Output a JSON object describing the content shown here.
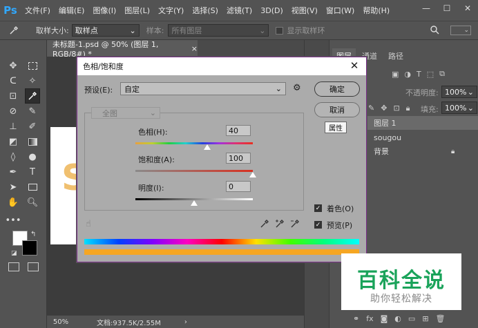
{
  "app": {
    "logo": "Ps",
    "menu": [
      "文件(F)",
      "编辑(E)",
      "图像(I)",
      "图层(L)",
      "文字(Y)",
      "选择(S)",
      "滤镜(T)",
      "3D(D)",
      "视图(V)",
      "窗口(W)",
      "帮助(H)"
    ],
    "window_controls": [
      "—",
      "☐",
      "✕"
    ]
  },
  "options_bar": {
    "sample_size_label": "取样大小:",
    "sample_size_value": "取样点",
    "sample_label": "样本:",
    "sample_value": "所有图层",
    "show_ring_label": "显示取样环"
  },
  "document": {
    "tab_title": "未标题-1.psd @ 50% (图层 1, RGB/8#) *",
    "tab_close": "×",
    "zoom": "50%",
    "doc_info": "文档:937.5K/2.55M",
    "canvas_letter": "S"
  },
  "layers_panel": {
    "tabs": [
      "图层",
      "通道",
      "路径"
    ],
    "opacity_label": "不透明度:",
    "opacity_value": "100%",
    "fill_label": "填充:",
    "fill_value": "100%",
    "layers": [
      {
        "name": "图层 1"
      },
      {
        "name": "sougou"
      },
      {
        "name": "背景"
      }
    ]
  },
  "dialog": {
    "title": "色相/饱和度",
    "preset_label": "预设(E):",
    "preset_value": "自定",
    "channel_value": "全图",
    "hue_label": "色相(H):",
    "hue_value": "40",
    "saturation_label": "饱和度(A):",
    "saturation_value": "100",
    "lightness_label": "明度(I):",
    "lightness_value": "0",
    "ok_label": "确定",
    "cancel_label": "取消",
    "colorize_label": "着色(O)",
    "preview_label": "预览(P)",
    "tooltip": "属性",
    "hue_fraction": 0.61,
    "saturation_fraction": 1.0,
    "lightness_fraction": 0.5
  },
  "watermark": {
    "title": "百科全说",
    "subtitle": "助你轻松解决"
  },
  "colors": {
    "accent": "#31a8ff",
    "dialog_border": "#7b2e8a",
    "watermark_green": "#1aa35a"
  }
}
